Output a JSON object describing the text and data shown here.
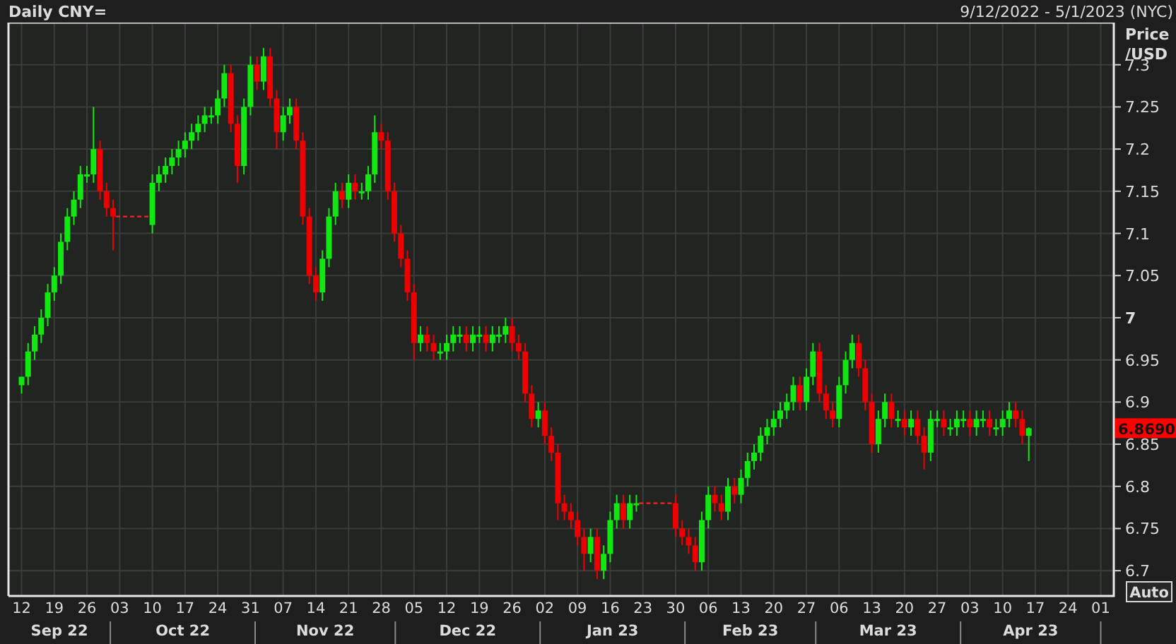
{
  "header": {
    "title": "Daily CNY=",
    "date_range": "9/12/2022 - 5/1/2023 (NYC)"
  },
  "chart": {
    "chart_data": {
      "type": "candlestick",
      "ylabel": "Price /USD",
      "ylim": [
        6.67,
        7.35
      ],
      "grid": true,
      "yticks": [
        7.3,
        7.25,
        7.2,
        7.15,
        7.1,
        7.05,
        7,
        6.95,
        6.9,
        6.85,
        6.8,
        6.75,
        6.7
      ],
      "categories": [
        "12",
        null,
        null,
        null,
        null,
        "19",
        null,
        null,
        null,
        null,
        "26",
        null,
        null,
        null,
        null,
        "03",
        null,
        null,
        null,
        null,
        "10",
        null,
        null,
        null,
        null,
        "17",
        null,
        null,
        null,
        null,
        "24",
        null,
        null,
        null,
        null,
        "31",
        null,
        null,
        null,
        null,
        "07",
        null,
        null,
        null,
        null,
        "14",
        null,
        null,
        null,
        null,
        "21",
        null,
        null,
        null,
        null,
        "28",
        null,
        null,
        null,
        null,
        "05",
        null,
        null,
        null,
        null,
        "12",
        null,
        null,
        null,
        null,
        "19",
        null,
        null,
        null,
        null,
        "26",
        null,
        null,
        null,
        null,
        "02",
        null,
        null,
        null,
        null,
        "09",
        null,
        null,
        null,
        null,
        "16",
        null,
        null,
        null,
        null,
        "23",
        null,
        null,
        null,
        null,
        "30",
        null,
        null,
        null,
        null,
        "06",
        null,
        null,
        null,
        null,
        "13",
        null,
        null,
        null,
        null,
        "20",
        null,
        null,
        null,
        null,
        "27",
        null,
        null,
        null,
        null,
        "06",
        null,
        null,
        null,
        null,
        "13",
        null,
        null,
        null,
        null,
        "20",
        null,
        null,
        null,
        null,
        "27",
        null,
        null,
        null,
        null,
        "03",
        null,
        null,
        null,
        null,
        "10",
        null,
        null,
        null,
        null,
        "17",
        null,
        null,
        null,
        null,
        "24",
        null,
        null,
        null,
        null,
        "01"
      ],
      "ohlc": [
        [
          6.92,
          6.93,
          6.91,
          6.93
        ],
        [
          6.93,
          6.97,
          6.92,
          6.96
        ],
        [
          6.96,
          6.99,
          6.95,
          6.98
        ],
        [
          6.98,
          7.01,
          6.97,
          7.0
        ],
        [
          7.0,
          7.04,
          6.99,
          7.03
        ],
        [
          7.03,
          7.06,
          7.02,
          7.05
        ],
        [
          7.05,
          7.1,
          7.04,
          7.09
        ],
        [
          7.09,
          7.13,
          7.08,
          7.12
        ],
        [
          7.12,
          7.15,
          7.11,
          7.14
        ],
        [
          7.14,
          7.18,
          7.13,
          7.17
        ],
        [
          7.17,
          7.18,
          7.16,
          7.17
        ],
        [
          7.17,
          7.25,
          7.16,
          7.2
        ],
        [
          7.2,
          7.21,
          7.14,
          7.15
        ],
        [
          7.15,
          7.16,
          7.12,
          7.13
        ],
        [
          7.13,
          7.14,
          7.08,
          7.12
        ],
        null,
        null,
        null,
        null,
        null,
        [
          7.11,
          7.17,
          7.1,
          7.16
        ],
        [
          7.16,
          7.18,
          7.15,
          7.17
        ],
        [
          7.17,
          7.19,
          7.16,
          7.18
        ],
        [
          7.18,
          7.2,
          7.17,
          7.19
        ],
        [
          7.19,
          7.21,
          7.18,
          7.2
        ],
        [
          7.2,
          7.22,
          7.19,
          7.21
        ],
        [
          7.21,
          7.23,
          7.2,
          7.22
        ],
        [
          7.22,
          7.24,
          7.21,
          7.23
        ],
        [
          7.23,
          7.25,
          7.22,
          7.24
        ],
        [
          7.24,
          7.25,
          7.23,
          7.24
        ],
        [
          7.24,
          7.27,
          7.23,
          7.26
        ],
        [
          7.26,
          7.3,
          7.25,
          7.29
        ],
        [
          7.29,
          7.3,
          7.22,
          7.23
        ],
        [
          7.23,
          7.24,
          7.16,
          7.18
        ],
        [
          7.18,
          7.26,
          7.17,
          7.25
        ],
        [
          7.25,
          7.31,
          7.24,
          7.3
        ],
        [
          7.3,
          7.31,
          7.27,
          7.28
        ],
        [
          7.28,
          7.32,
          7.27,
          7.31
        ],
        [
          7.31,
          7.32,
          7.25,
          7.26
        ],
        [
          7.26,
          7.27,
          7.2,
          7.22
        ],
        [
          7.22,
          7.25,
          7.21,
          7.24
        ],
        [
          7.24,
          7.26,
          7.23,
          7.25
        ],
        [
          7.25,
          7.26,
          7.2,
          7.21
        ],
        [
          7.21,
          7.22,
          7.11,
          7.12
        ],
        [
          7.12,
          7.13,
          7.04,
          7.05
        ],
        [
          7.05,
          7.06,
          7.02,
          7.03
        ],
        [
          7.03,
          7.08,
          7.02,
          7.07
        ],
        [
          7.07,
          7.13,
          7.06,
          7.12
        ],
        [
          7.12,
          7.16,
          7.11,
          7.15
        ],
        [
          7.15,
          7.16,
          7.13,
          7.14
        ],
        [
          7.14,
          7.17,
          7.13,
          7.16
        ],
        [
          7.16,
          7.17,
          7.14,
          7.15
        ],
        [
          7.15,
          7.16,
          7.14,
          7.15
        ],
        [
          7.15,
          7.18,
          7.14,
          7.17
        ],
        [
          7.17,
          7.24,
          7.16,
          7.22
        ],
        [
          7.22,
          7.23,
          7.2,
          7.21
        ],
        [
          7.21,
          7.22,
          7.14,
          7.15
        ],
        [
          7.15,
          7.16,
          7.09,
          7.1
        ],
        [
          7.1,
          7.11,
          7.06,
          7.07
        ],
        [
          7.07,
          7.08,
          7.02,
          7.03
        ],
        [
          7.03,
          7.04,
          6.95,
          6.97
        ],
        [
          6.97,
          6.99,
          6.96,
          6.98
        ],
        [
          6.98,
          6.99,
          6.96,
          6.97
        ],
        [
          6.97,
          6.98,
          6.95,
          6.96
        ],
        [
          6.96,
          6.97,
          6.95,
          6.96
        ],
        [
          6.96,
          6.98,
          6.95,
          6.97
        ],
        [
          6.97,
          6.99,
          6.96,
          6.98
        ],
        [
          6.98,
          6.99,
          6.97,
          6.98
        ],
        [
          6.98,
          6.99,
          6.96,
          6.97
        ],
        [
          6.97,
          6.99,
          6.96,
          6.98
        ],
        [
          6.98,
          6.99,
          6.97,
          6.98
        ],
        [
          6.98,
          6.99,
          6.96,
          6.97
        ],
        [
          6.97,
          6.99,
          6.96,
          6.98
        ],
        [
          6.98,
          6.99,
          6.97,
          6.98
        ],
        [
          6.98,
          7.0,
          6.97,
          6.99
        ],
        [
          6.99,
          7.0,
          6.96,
          6.97
        ],
        [
          6.97,
          6.98,
          6.95,
          6.96
        ],
        [
          6.96,
          6.97,
          6.9,
          6.91
        ],
        [
          6.91,
          6.92,
          6.87,
          6.88
        ],
        [
          6.88,
          6.9,
          6.87,
          6.89
        ],
        [
          6.89,
          6.9,
          6.85,
          6.86
        ],
        [
          6.86,
          6.87,
          6.83,
          6.84
        ],
        [
          6.84,
          6.85,
          6.76,
          6.78
        ],
        [
          6.78,
          6.79,
          6.76,
          6.77
        ],
        [
          6.77,
          6.78,
          6.75,
          6.76
        ],
        [
          6.76,
          6.77,
          6.73,
          6.74
        ],
        [
          6.74,
          6.75,
          6.7,
          6.72
        ],
        [
          6.72,
          6.75,
          6.71,
          6.74
        ],
        [
          6.74,
          6.75,
          6.69,
          6.7
        ],
        [
          6.7,
          6.73,
          6.69,
          6.72
        ],
        [
          6.72,
          6.77,
          6.71,
          6.76
        ],
        [
          6.76,
          6.79,
          6.75,
          6.78
        ],
        [
          6.78,
          6.79,
          6.75,
          6.76
        ],
        [
          6.76,
          6.79,
          6.75,
          6.78
        ],
        [
          6.78,
          6.79,
          6.77,
          6.78
        ],
        null,
        null,
        null,
        null,
        null,
        [
          6.78,
          6.79,
          6.74,
          6.75
        ],
        [
          6.75,
          6.76,
          6.73,
          6.74
        ],
        [
          6.74,
          6.75,
          6.72,
          6.73
        ],
        [
          6.73,
          6.74,
          6.7,
          6.71
        ],
        [
          6.71,
          6.77,
          6.7,
          6.76
        ],
        [
          6.76,
          6.8,
          6.75,
          6.79
        ],
        [
          6.79,
          6.8,
          6.77,
          6.78
        ],
        [
          6.78,
          6.79,
          6.76,
          6.77
        ],
        [
          6.77,
          6.81,
          6.76,
          6.8
        ],
        [
          6.8,
          6.81,
          6.78,
          6.79
        ],
        [
          6.79,
          6.82,
          6.78,
          6.81
        ],
        [
          6.81,
          6.84,
          6.8,
          6.83
        ],
        [
          6.83,
          6.85,
          6.82,
          6.84
        ],
        [
          6.84,
          6.87,
          6.83,
          6.86
        ],
        [
          6.86,
          6.88,
          6.85,
          6.87
        ],
        [
          6.87,
          6.89,
          6.86,
          6.88
        ],
        [
          6.88,
          6.9,
          6.87,
          6.89
        ],
        [
          6.89,
          6.91,
          6.88,
          6.9
        ],
        [
          6.9,
          6.93,
          6.89,
          6.92
        ],
        [
          6.92,
          6.93,
          6.89,
          6.9
        ],
        [
          6.9,
          6.94,
          6.89,
          6.93
        ],
        [
          6.93,
          6.97,
          6.92,
          6.96
        ],
        [
          6.96,
          6.97,
          6.9,
          6.91
        ],
        [
          6.91,
          6.92,
          6.88,
          6.89
        ],
        [
          6.89,
          6.9,
          6.87,
          6.88
        ],
        [
          6.88,
          6.93,
          6.87,
          6.92
        ],
        [
          6.92,
          6.96,
          6.91,
          6.95
        ],
        [
          6.95,
          6.98,
          6.94,
          6.97
        ],
        [
          6.97,
          6.98,
          6.93,
          6.94
        ],
        [
          6.94,
          6.95,
          6.89,
          6.9
        ],
        [
          6.9,
          6.91,
          6.84,
          6.85
        ],
        [
          6.85,
          6.89,
          6.84,
          6.88
        ],
        [
          6.88,
          6.91,
          6.87,
          6.9
        ],
        [
          6.9,
          6.91,
          6.87,
          6.88
        ],
        [
          6.88,
          6.89,
          6.87,
          6.88
        ],
        [
          6.88,
          6.89,
          6.86,
          6.87
        ],
        [
          6.87,
          6.89,
          6.86,
          6.88
        ],
        [
          6.88,
          6.89,
          6.85,
          6.86
        ],
        [
          6.86,
          6.87,
          6.82,
          6.84
        ],
        [
          6.84,
          6.89,
          6.83,
          6.88
        ],
        [
          6.88,
          6.89,
          6.87,
          6.88
        ],
        [
          6.88,
          6.89,
          6.86,
          6.87
        ],
        [
          6.87,
          6.88,
          6.86,
          6.87
        ],
        [
          6.87,
          6.89,
          6.86,
          6.88
        ],
        [
          6.88,
          6.89,
          6.87,
          6.88
        ],
        [
          6.88,
          6.89,
          6.86,
          6.87
        ],
        [
          6.87,
          6.89,
          6.86,
          6.88
        ],
        [
          6.88,
          6.89,
          6.87,
          6.88
        ],
        [
          6.88,
          6.89,
          6.86,
          6.87
        ],
        [
          6.87,
          6.88,
          6.86,
          6.87
        ],
        [
          6.87,
          6.89,
          6.86,
          6.88
        ],
        [
          6.88,
          6.9,
          6.87,
          6.89
        ],
        [
          6.89,
          6.9,
          6.87,
          6.88
        ],
        [
          6.88,
          6.89,
          6.85,
          6.86
        ],
        [
          6.86,
          6.87,
          6.83,
          6.869
        ],
        null,
        null,
        null,
        null,
        null,
        null,
        null,
        null,
        null,
        null,
        null
      ]
    },
    "month_labels": [
      "Sep 22",
      "Oct 22",
      "Nov 22",
      "Dec 22",
      "Jan 23",
      "Feb 23",
      "Mar 23",
      "Apr 23"
    ],
    "last_price_tag": "6.8690",
    "auto_button": "Auto"
  }
}
